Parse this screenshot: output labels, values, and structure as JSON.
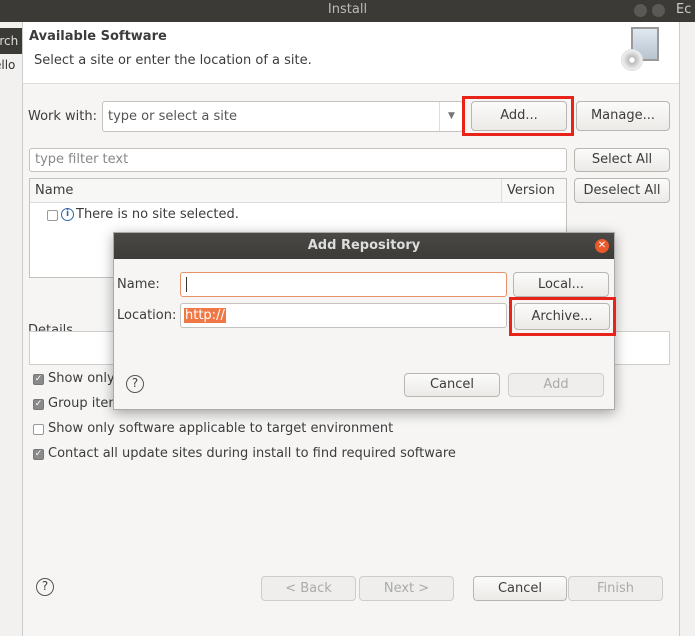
{
  "window": {
    "title": "Install",
    "bg_left_snippets": [
      "arch",
      "ello"
    ],
    "bg_right_snippet": "Ec"
  },
  "header": {
    "title": "Available Software",
    "subtitle": "Select a site or enter the location of a site."
  },
  "work_with": {
    "label": "Work with:",
    "placeholder": "type or select a site",
    "add_label": "Add...",
    "manage_label": "Manage..."
  },
  "filter": {
    "placeholder": "type filter text",
    "select_all": "Select All",
    "deselect_all": "Deselect All"
  },
  "table": {
    "columns": [
      "Name",
      "Version"
    ],
    "empty_message": "There is no site selected."
  },
  "details": {
    "label": "Details"
  },
  "options": [
    {
      "label": "Show only the latest versions of available software",
      "checked": true
    },
    {
      "label": "Group items by category",
      "checked": true
    },
    {
      "label": "Show only software applicable to target environment",
      "checked": false
    },
    {
      "label": "Contact all update sites during install to find required software",
      "checked": true
    }
  ],
  "footer": {
    "back": "< Back",
    "next": "Next >",
    "cancel": "Cancel",
    "finish": "Finish"
  },
  "add_repository": {
    "title": "Add Repository",
    "name_label": "Name:",
    "name_value": "",
    "local_label": "Local...",
    "location_label": "Location:",
    "location_value": "http://",
    "archive_label": "Archive...",
    "cancel": "Cancel",
    "add": "Add"
  },
  "colors": {
    "highlight": "#e8231a",
    "selection": "#f07746"
  }
}
